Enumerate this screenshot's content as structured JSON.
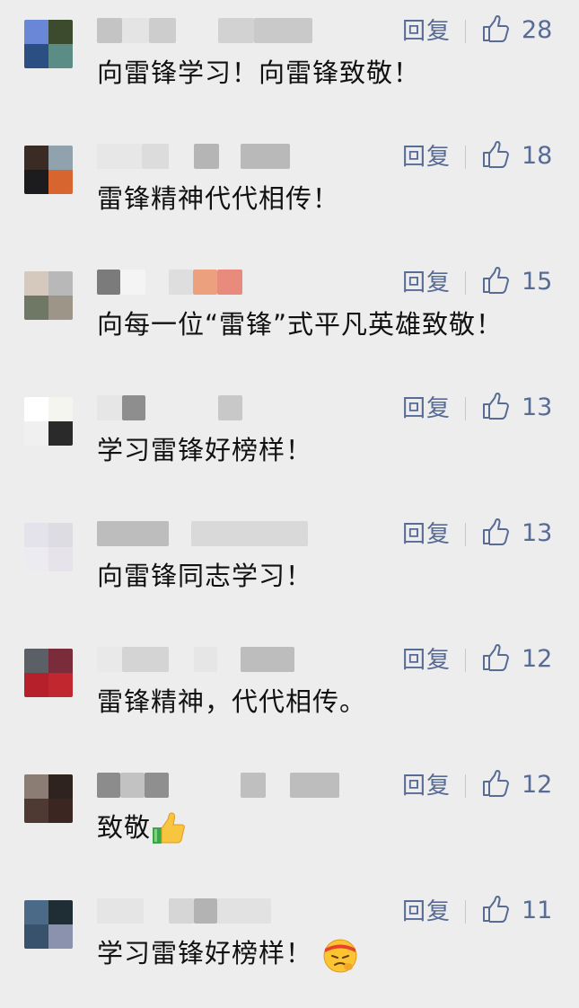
{
  "reply_label": "回复",
  "comments": [
    {
      "text": "向雷锋学习！向雷锋致敬！",
      "likes": "28",
      "avatar": [
        "#6a86d6",
        "#3c4b2e",
        "#2b4f82",
        "#5b8d86"
      ]
    },
    {
      "text": "雷锋精神代代相传！",
      "likes": "18",
      "avatar": [
        "#3a2c25",
        "#8fa2ad",
        "#1c1c1e",
        "#d6652f"
      ]
    },
    {
      "text": "向每一位“雷锋”式平凡英雄致敬！",
      "likes": "15",
      "avatar": [
        "#d5c9bd",
        "#b8b8b8",
        "#6f7864",
        "#9c9588"
      ]
    },
    {
      "text": "学习雷锋好榜样！",
      "likes": "13",
      "avatar": [
        "#ffffff",
        "#f5f5f0",
        "#f0f0f0",
        "#2a2a2a"
      ]
    },
    {
      "text": "向雷锋同志学习！",
      "likes": "13",
      "avatar": [
        "#e4e2ea",
        "#dcdce2",
        "#ecebef",
        "#e6e4ea"
      ]
    },
    {
      "text": "雷锋精神，代代相传。",
      "likes": "12",
      "avatar": [
        "#5b5f66",
        "#7a2c3a",
        "#b5202a",
        "#c0272e"
      ]
    },
    {
      "text": "致敬",
      "likes": "12",
      "avatar": [
        "#8b7d73",
        "#2f2320",
        "#4e3a33",
        "#3b2621"
      ]
    },
    {
      "text": "学习雷锋好榜样！",
      "likes": "11",
      "avatar": [
        "#4a6a87",
        "#1f2e34",
        "#38516d",
        "#8b92ad"
      ]
    }
  ]
}
